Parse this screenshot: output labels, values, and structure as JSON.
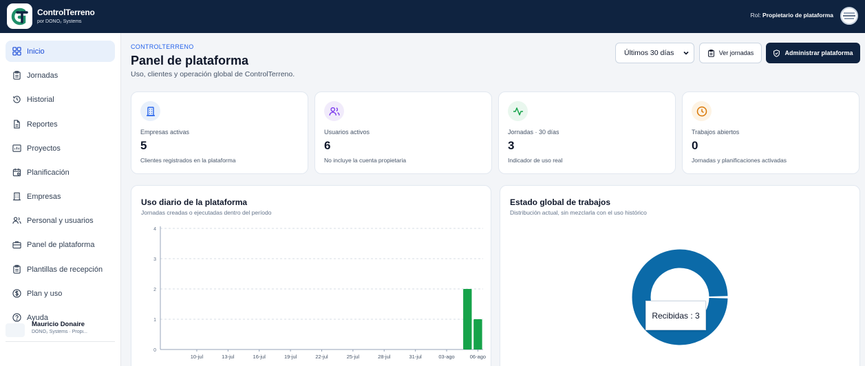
{
  "brand": {
    "title": "ControlTerreno",
    "subtitle": "por DONO₂ Systems"
  },
  "topbar": {
    "role_label": "Rol:",
    "role_value": "Propietario de plataforma"
  },
  "sidebar": {
    "items": [
      {
        "label": "Inicio",
        "icon": "grid-icon",
        "active": true
      },
      {
        "label": "Jornadas",
        "icon": "clipboard-icon"
      },
      {
        "label": "Historial",
        "icon": "history-icon"
      },
      {
        "label": "Reportes",
        "icon": "file-icon"
      },
      {
        "label": "Proyectos",
        "icon": "chart-icon"
      },
      {
        "label": "Planificación",
        "icon": "calendar-icon"
      },
      {
        "label": "Empresas",
        "icon": "building-icon"
      },
      {
        "label": "Personal y usuarios",
        "icon": "users-icon"
      },
      {
        "label": "Panel de plataforma",
        "icon": "briefcase-icon"
      },
      {
        "label": "Plantillas de recepción",
        "icon": "clipboard-icon"
      },
      {
        "label": "Plan y uso",
        "icon": "dollar-icon"
      },
      {
        "label": "Ayuda",
        "icon": "help-icon"
      }
    ],
    "user": {
      "name": "Mauricio Donaire",
      "sub": "DONO₂ Systems · Propi..."
    }
  },
  "header": {
    "eyebrow": "CONTROLTERRENO",
    "title": "Panel de plataforma",
    "subtitle": "Uso, clientes y operación global de ControlTerreno.",
    "period_select": "Últimos 30 días",
    "btn_jornadas": "Ver jornadas",
    "btn_admin": "Administrar plataforma"
  },
  "kpis": [
    {
      "label": "Empresas activas",
      "value": "5",
      "note": "Clientes registrados en la plataforma",
      "color": "#2563eb",
      "bg": "#e8f0fb",
      "icon": "building-icon"
    },
    {
      "label": "Usuarios activos",
      "value": "6",
      "note": "No incluye la cuenta propietaria",
      "color": "#7c3aed",
      "bg": "#f1ebfb",
      "icon": "users-icon"
    },
    {
      "label": "Jornadas · 30 días",
      "value": "3",
      "note": "Indicador de uso real",
      "color": "#16a34a",
      "bg": "#e9f7ee",
      "icon": "activity-icon"
    },
    {
      "label": "Trabajos abiertos",
      "value": "0",
      "note": "Jornadas y planificaciones activadas",
      "color": "#d97706",
      "bg": "#fdf3e4",
      "icon": "clock-icon"
    }
  ],
  "usage_card": {
    "title": "Uso diario de la plataforma",
    "subtitle": "Jornadas creadas o ejecutadas dentro del período"
  },
  "status_card": {
    "title": "Estado global de trabajos",
    "subtitle": "Distribución actual, sin mezclarla con el uso histórico",
    "tooltip": "Recibidas : 3"
  },
  "chart_data": [
    {
      "type": "bar",
      "title": "Uso diario de la plataforma",
      "categories": [
        "10-jul",
        "13-jul",
        "16-jul",
        "19-jul",
        "22-jul",
        "25-jul",
        "28-jul",
        "31-jul",
        "03-ago",
        "06-ago"
      ],
      "x": [
        "05-ago",
        "06-ago"
      ],
      "values": [
        2,
        1
      ],
      "ylim": [
        0,
        4
      ],
      "yticks": [
        0,
        1,
        2,
        3,
        4
      ],
      "grid": true,
      "color": "#16a34a"
    },
    {
      "type": "pie",
      "title": "Estado global de trabajos",
      "labels": [
        "Recibidas"
      ],
      "values": [
        3
      ],
      "color": "#0b6aa8"
    }
  ]
}
